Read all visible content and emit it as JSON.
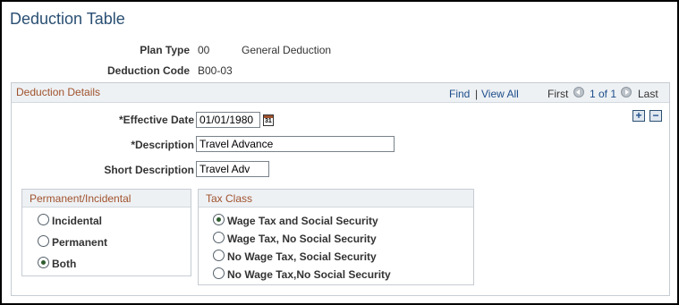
{
  "page": {
    "title": "Deduction Table"
  },
  "header": {
    "plan_type_label": "Plan Type",
    "plan_type_code": "00",
    "plan_type_desc": "General Deduction",
    "deduction_code_label": "Deduction Code",
    "deduction_code_value": "B00-03"
  },
  "details": {
    "section_title": "Deduction Details",
    "nav": {
      "find": "Find",
      "separator": "|",
      "view_all": "View All",
      "first": "First",
      "range": "1 of 1",
      "last": "Last"
    },
    "add_button": "+",
    "delete_button": "−",
    "effective_date_label": "*Effective Date",
    "effective_date_value": "01/01/1980",
    "calendar_glyph": "31",
    "description_label": "*Description",
    "description_value": "Travel Advance",
    "short_description_label": "Short Description",
    "short_description_value": "Travel Adv"
  },
  "permanent_incidental": {
    "title": "Permanent/Incidental",
    "options": [
      {
        "label": "Incidental",
        "checked": false
      },
      {
        "label": "Permanent",
        "checked": false
      },
      {
        "label": "Both",
        "checked": true
      }
    ]
  },
  "tax_class": {
    "title": "Tax Class",
    "options": [
      {
        "label": "Wage Tax and Social Security",
        "checked": true
      },
      {
        "label": "Wage Tax, No Social Security",
        "checked": false
      },
      {
        "label": "No Wage Tax, Social Security",
        "checked": false
      },
      {
        "label": "No Wage Tax,No Social Security",
        "checked": false
      }
    ]
  },
  "colors": {
    "title": "#2a4f73",
    "section_title": "#a0522d",
    "link": "#1e4e8c",
    "header_bg": "#eef1f4"
  }
}
